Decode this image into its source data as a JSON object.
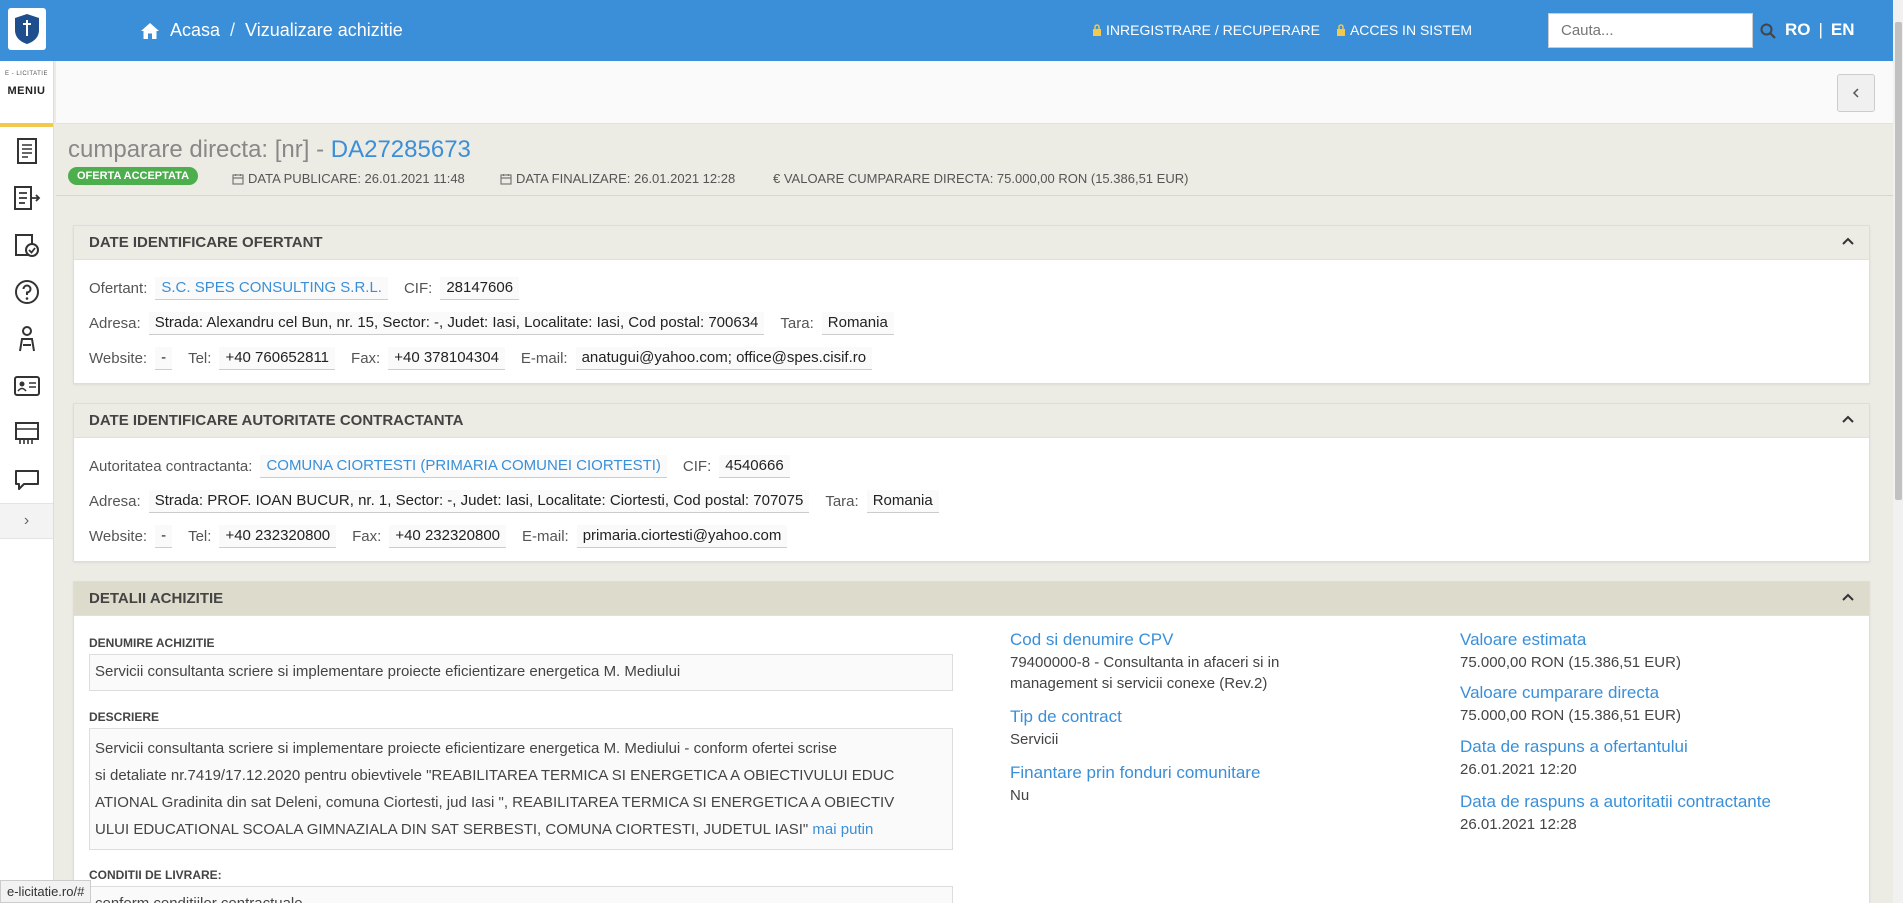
{
  "topbar": {
    "breadcrumb": {
      "home": "Acasa",
      "sep": "/",
      "current": "Vizualizare achizitie"
    },
    "auth": {
      "register": "INREGISTRARE / RECUPERARE",
      "login": "ACCES IN SISTEM"
    },
    "search": {
      "placeholder": "Cauta..."
    },
    "lang": {
      "ro": "RO",
      "pipe": "|",
      "en": "EN"
    },
    "accent": "#3a8fd8"
  },
  "sidebar": {
    "brand": "E - LICITATIE",
    "menu": "MENIU",
    "expand": "›"
  },
  "header": {
    "title_prefix": "cumparare directa: [nr] -",
    "code": "DA27285673",
    "status": "OFERTA ACCEPTATA",
    "data_publicare": "DATA PUBLICARE: 26.01.2021 11:48",
    "data_finalizare": "DATA FINALIZARE: 26.01.2021 12:28",
    "valoare": "€ VALOARE CUMPARARE DIRECTA: 75.000,00  RON (15.386,51  EUR)"
  },
  "ofertant": {
    "heading": "DATE IDENTIFICARE OFERTANT",
    "labels": {
      "ofertant": "Ofertant:",
      "cif": "CIF:",
      "adresa": "Adresa:",
      "tara": "Tara:",
      "website": "Website:",
      "tel": "Tel:",
      "fax": "Fax:",
      "email": "E-mail:"
    },
    "name": "S.C. SPES CONSULTING S.R.L.",
    "cif": "28147606",
    "adresa": "Strada: Alexandru cel Bun, nr. 15, Sector: -, Judet: Iasi, Localitate: Iasi, Cod postal: 700634",
    "tara": "Romania",
    "website": "-",
    "tel": "+40 760652811",
    "fax": "+40 378104304",
    "email": "anatugui@yahoo.com; office@spes.cisif.ro"
  },
  "autoritate": {
    "heading": "DATE IDENTIFICARE AUTORITATE CONTRACTANTA",
    "labels": {
      "autoritate": "Autoritatea contractanta:",
      "cif": "CIF:",
      "adresa": "Adresa:",
      "tara": "Tara:",
      "website": "Website:",
      "tel": "Tel:",
      "fax": "Fax:",
      "email": "E-mail:"
    },
    "name": "COMUNA CIORTESTI (PRIMARIA COMUNEI CIORTESTI)",
    "cif": "4540666",
    "adresa": "Strada: PROF. IOAN BUCUR, nr. 1, Sector: -, Judet: Iasi, Localitate: Ciortesti, Cod postal: 707075",
    "tara": "Romania",
    "website": "-",
    "tel": "+40 232320800",
    "fax": "+40 232320800",
    "email": "primaria.ciortesti@yahoo.com"
  },
  "detalii": {
    "heading": "DETALII ACHIZITIE",
    "denumire_label": "DENUMIRE ACHIZITIE",
    "denumire": "Servicii consultanta scriere si implementare proiecte eficientizare energetica M. Mediului",
    "descriere_label": "DESCRIERE",
    "descriere_lines": [
      "Servicii consultanta scriere si implementare proiecte eficientizare energetica M. Mediului - conform ofertei scrise",
      "si detaliate nr.7419/17.12.2020 pentru obievtivele \"REABILITAREA TERMICA SI ENERGETICA A OBIECTIVULUI EDUC",
      "ATIONAL Gradinita din sat Deleni, comuna Ciortesti, jud Iasi \", REABILITAREA TERMICA SI ENERGETICA A OBIECTIV",
      "ULUI EDUCATIONAL SCOALA GIMNAZIALA DIN SAT SERBESTI, COMUNA CIORTESTI, JUDETUL IASI\""
    ],
    "mai_putin": "mai putin",
    "conditii_label": "CONDITII DE LIVRARE:",
    "conditii": "conform conditiilor contractuale",
    "cpv_title": "Cod si denumire CPV",
    "cpv_lines": [
      "79400000-8 - Consultanta in afaceri si in",
      "management si servicii conexe (Rev.2)"
    ],
    "tip_title": "Tip de contract",
    "tip": "Servicii",
    "fonduri_title": "Finantare prin fonduri comunitare",
    "fonduri": "Nu",
    "val_est_title": "Valoare estimata",
    "val_est": "75.000,00  RON (15.386,51  EUR)",
    "val_cd_title": "Valoare cumparare directa",
    "val_cd": "75.000,00  RON (15.386,51  EUR)",
    "raspuns_of_title": "Data de raspuns a ofertantului",
    "raspuns_of": "26.01.2021 12:20",
    "raspuns_aut_title": "Data de raspuns a autoritatii contractante",
    "raspuns_aut": "26.01.2021 12:28"
  },
  "status_url": "e-licitatie.ro/#"
}
